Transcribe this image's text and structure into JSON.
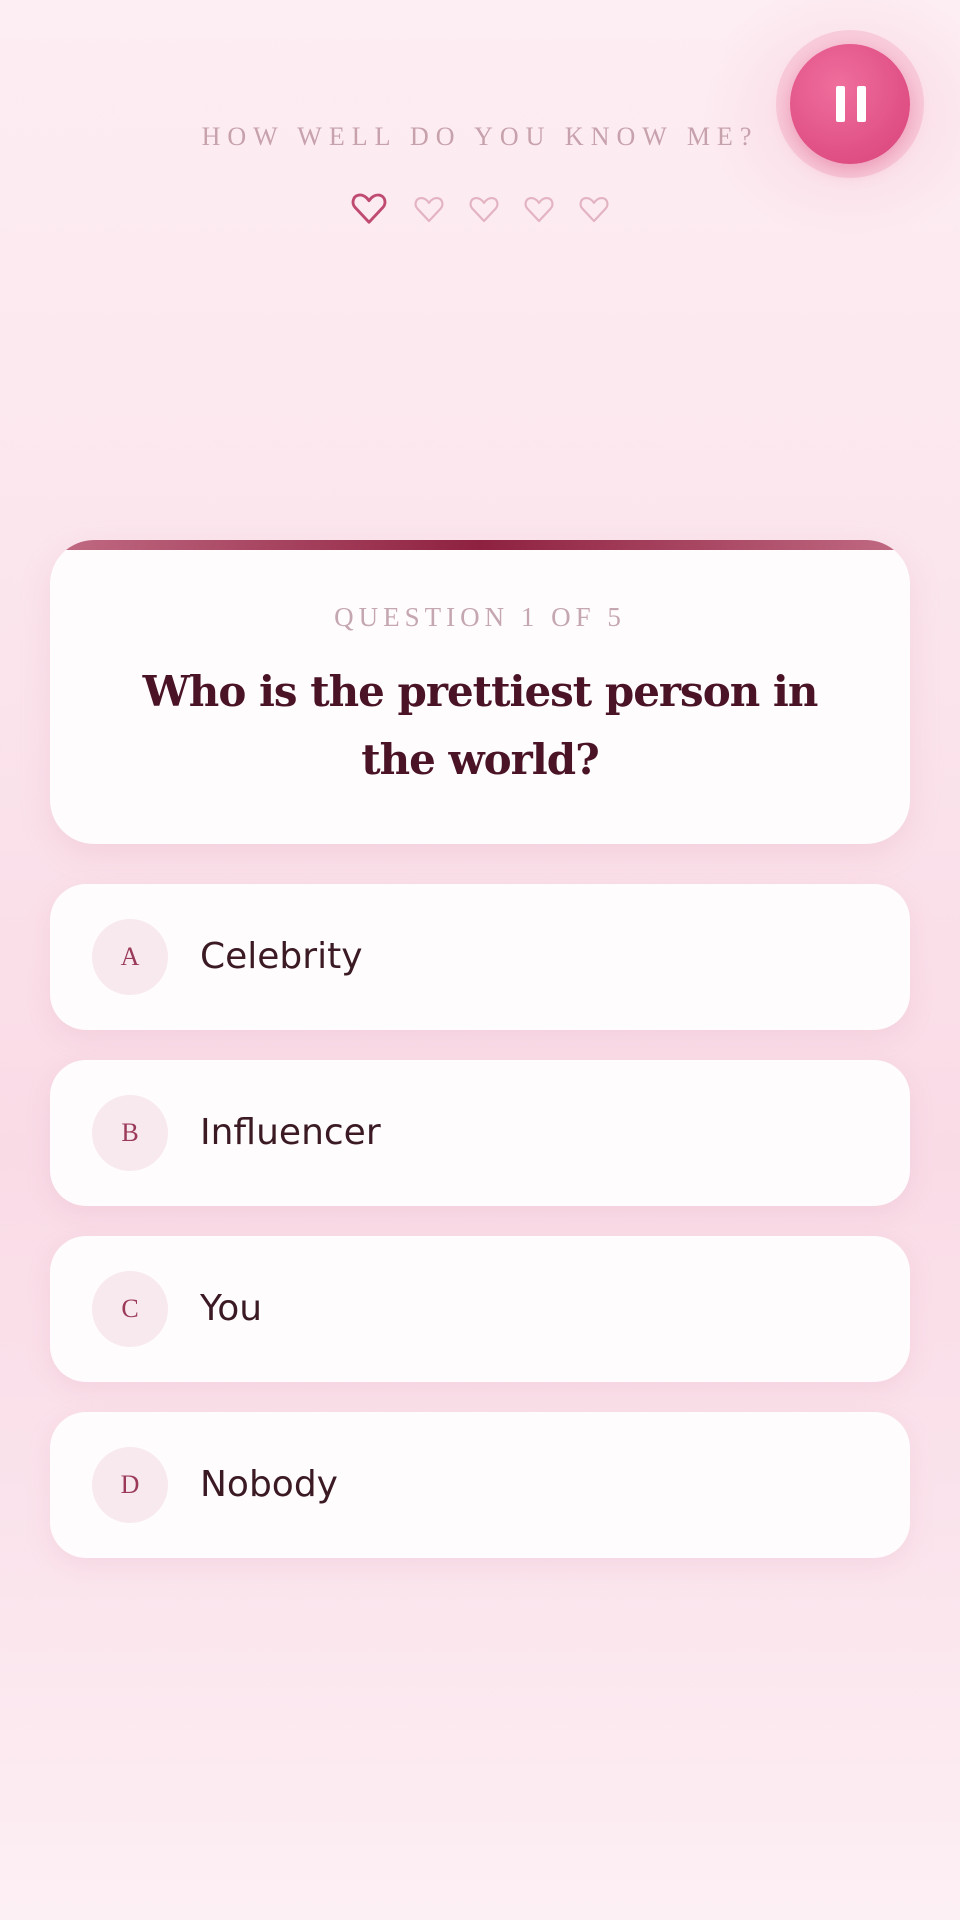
{
  "header": {
    "title": "HOW WELL DO YOU KNOW ME?"
  },
  "controls": {
    "pause_icon": "pause-icon",
    "pause_color": "#df4f84"
  },
  "progress": {
    "total": 5,
    "current": 1,
    "icon": "heart-icon",
    "active_color": "#c04b71",
    "inactive_color": "#e3b3c2"
  },
  "question": {
    "counter": "QUESTION 1 OF 5",
    "text": "Who is the prettiest person in the world?"
  },
  "options": [
    {
      "letter": "A",
      "text": "Celebrity"
    },
    {
      "letter": "B",
      "text": "Influencer"
    },
    {
      "letter": "C",
      "text": "You"
    },
    {
      "letter": "D",
      "text": "Nobody"
    }
  ]
}
